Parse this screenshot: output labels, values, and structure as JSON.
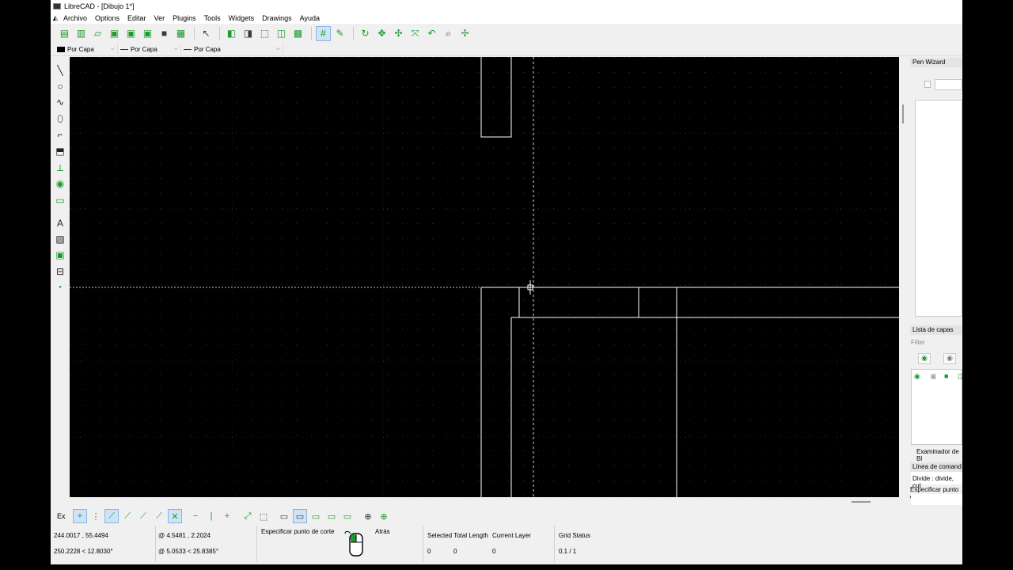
{
  "window": {
    "title": "LibreCAD - [Dibujo 1*]"
  },
  "menu": {
    "lead": "◭",
    "items": [
      "Archivo",
      "Options",
      "Editar",
      "Ver",
      "Plugins",
      "Tools",
      "Widgets",
      "Drawings",
      "Ayuda"
    ]
  },
  "pen_toolbar": {
    "color": "Por Capa",
    "width": "Por Capa",
    "linetype": "Por Capa"
  },
  "right_panel": {
    "pen_wizard": "Pen Wizard",
    "layer_list": "Lista de capas",
    "filter_placeholder": "Filter",
    "block_browser": "Examinador de Bl",
    "command_line": "Línea de comand",
    "command_history": "Divide : divide, cut",
    "command_prompt": "Especificar punto de"
  },
  "status": {
    "snap_label": "Ex",
    "abs_coords": "244.0017 , 55.4494",
    "abs_polar": "250.2228 < 12.8030°",
    "rel_coords": "@  4.5481 , 2.2024",
    "rel_polar": "@  5.0533 < 25.8385°",
    "prompt_left": "Especificar punto de corte",
    "prompt_right": "Atrás",
    "selected_label": "Selected Total Length",
    "selected_count": "0",
    "selected_length": "0",
    "current_layer_label": "Current Layer",
    "current_layer_value": "0",
    "grid_status_label": "Grid Status",
    "grid_status_value": "0.1 / 1"
  },
  "colors": {
    "canvas": "#000000",
    "grid_dot": "#3a3a3a",
    "entity": "#ffffff",
    "crosshair": "#d8d8d8",
    "accent": "#1c9a2a"
  }
}
